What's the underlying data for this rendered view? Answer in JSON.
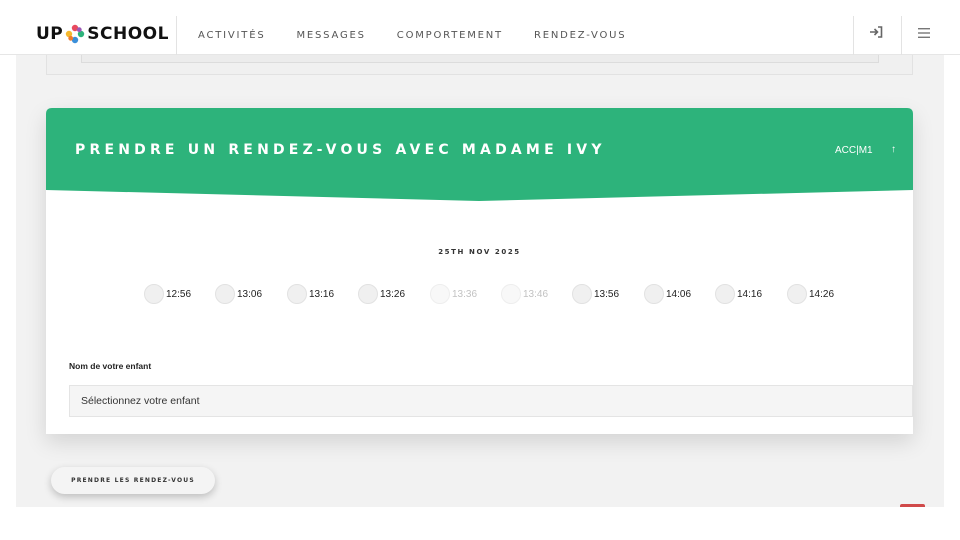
{
  "header": {
    "logo": {
      "text_left": "UP",
      "text_right": "SCHOOL"
    },
    "nav": [
      {
        "label": "ACTIVITÉS"
      },
      {
        "label": "MESSAGES"
      },
      {
        "label": "COMPORTEMENT"
      },
      {
        "label": "RENDEZ-VOUS"
      }
    ],
    "icons": {
      "login": "sign-in-icon",
      "menu": "hamburger-menu-icon"
    }
  },
  "card": {
    "title": "PRENDRE UN RENDEZ-VOUS AVEC MADAME IVY",
    "class_label": "ACC|M1",
    "toggle_icon": "↑",
    "accent_color": "#2db37b",
    "date": "25TH NOV 2025",
    "slots": [
      {
        "time": "12:56",
        "available": true
      },
      {
        "time": "13:06",
        "available": true
      },
      {
        "time": "13:16",
        "available": true
      },
      {
        "time": "13:26",
        "available": true
      },
      {
        "time": "13:36",
        "available": false
      },
      {
        "time": "13:46",
        "available": false
      },
      {
        "time": "13:56",
        "available": true
      },
      {
        "time": "14:06",
        "available": true
      },
      {
        "time": "14:16",
        "available": true
      },
      {
        "time": "14:26",
        "available": true
      }
    ],
    "child_field": {
      "label": "Nom de votre enfant",
      "placeholder": "Sélectionnez votre enfant"
    }
  },
  "submit_button": {
    "label": "PRENDRE LES RENDEZ-VOUS"
  }
}
